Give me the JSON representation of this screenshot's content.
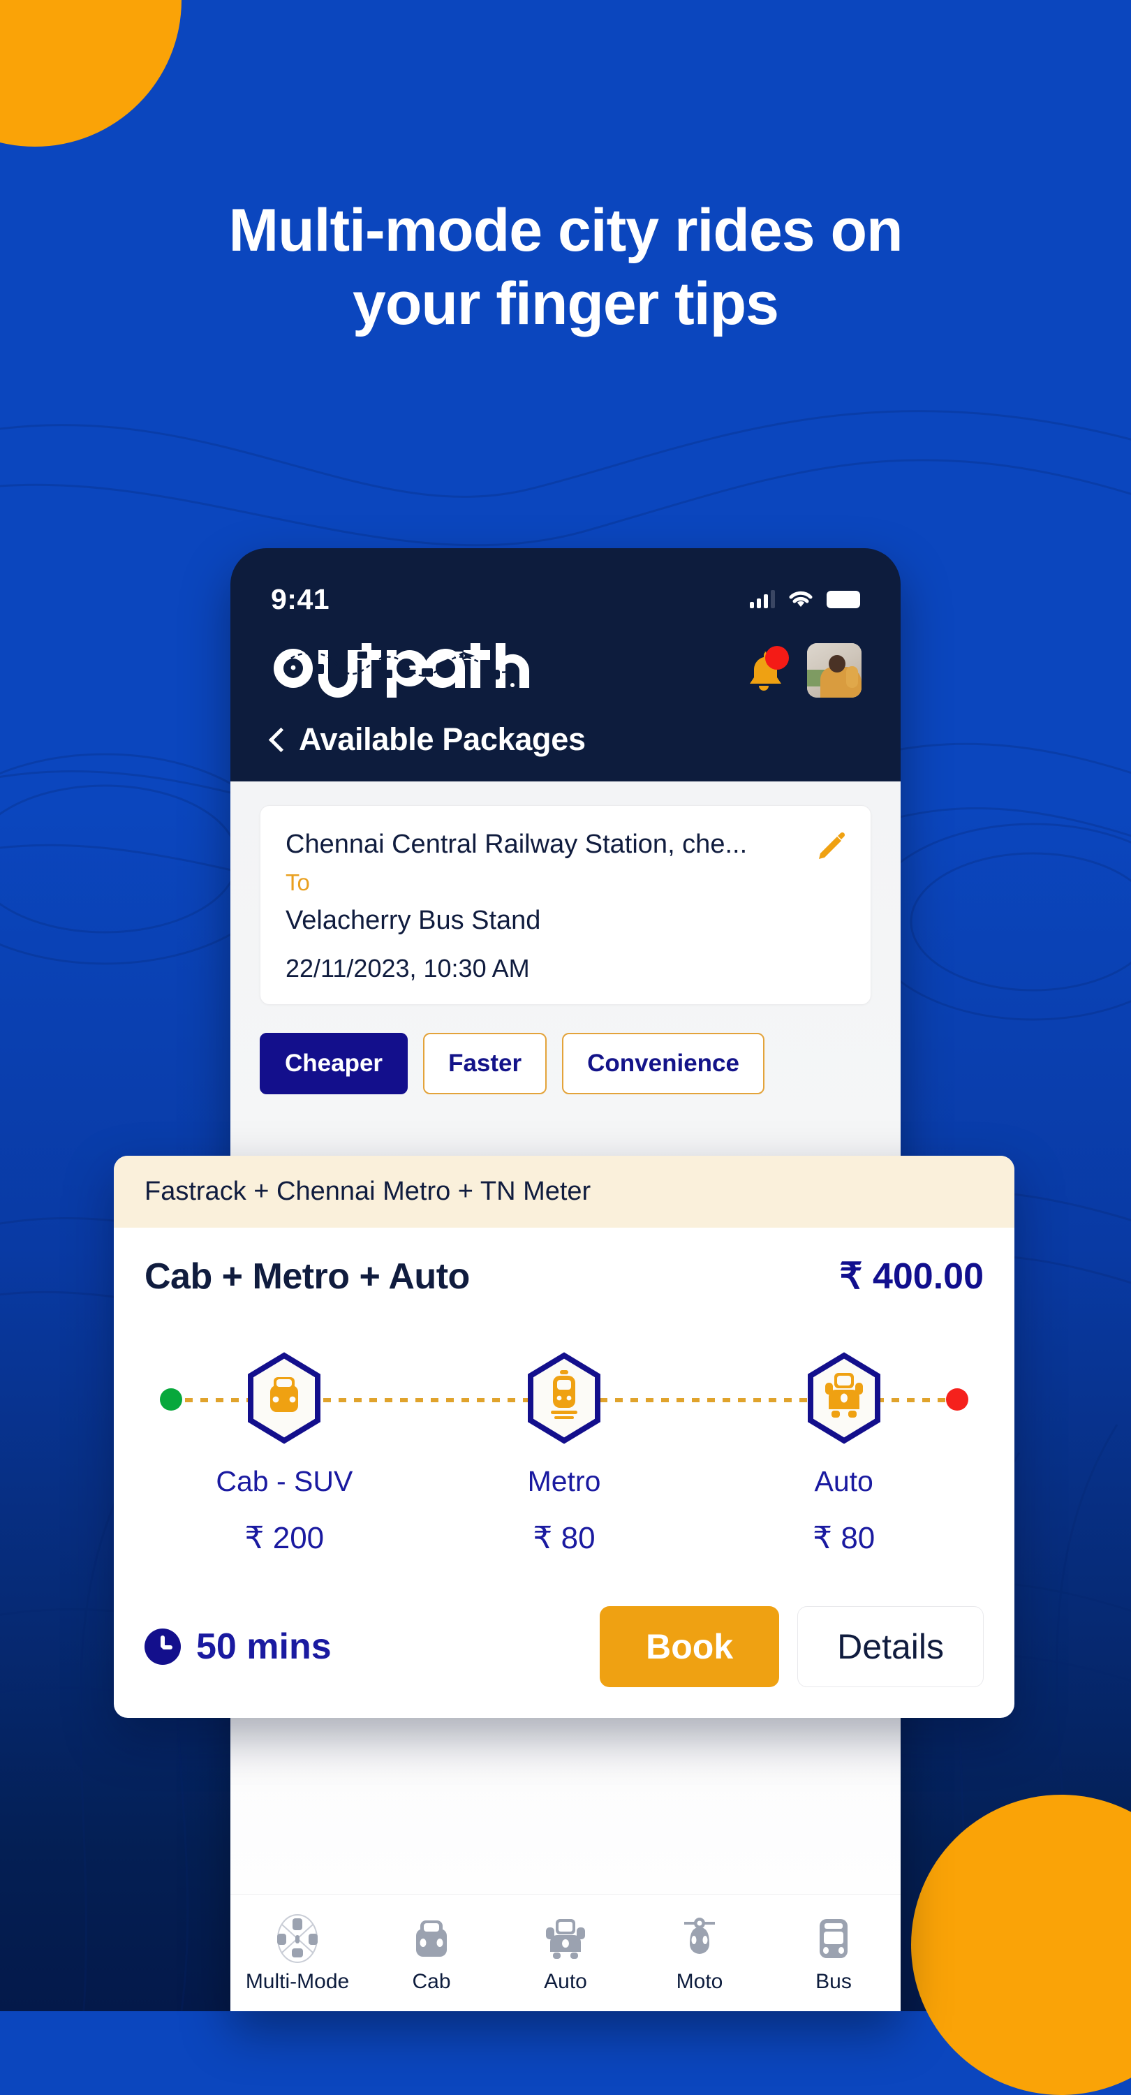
{
  "promo": {
    "headline_line1": "Multi-mode city rides on",
    "headline_line2": "your finger tips"
  },
  "colors": {
    "background_blue": "#0B46BE",
    "accent_orange": "#FAA307",
    "brand_navy": "#130F8C",
    "card_cream": "#FAF0DB",
    "start_dot_green": "#07A83C",
    "end_dot_red": "#F5211C"
  },
  "phone": {
    "status_bar": {
      "time": "9:41",
      "signal_icon": "cellular-signal-icon",
      "wifi_icon": "wifi-icon",
      "battery_icon": "battery-icon"
    },
    "app_header": {
      "logo_text": "outpath",
      "bell_icon": "notification-bell-icon",
      "has_notification_badge": true,
      "avatar_icon": "user-avatar"
    },
    "page": {
      "back_icon": "chevron-left-icon",
      "title": "Available Packages"
    },
    "route_card": {
      "from": "Chennai Central Railway Station, che...",
      "to_label": "To",
      "to": "Velacherry Bus Stand",
      "datetime": "22/11/2023,   10:30 AM",
      "edit_icon": "pencil-edit-icon"
    },
    "filters": [
      {
        "label": "Cheaper",
        "active": true
      },
      {
        "label": "Faster",
        "active": false
      },
      {
        "label": "Convenience",
        "active": false
      }
    ],
    "inline_package": {
      "nodes": [
        {
          "name": "Cab - SUV",
          "price": "₹ 200",
          "icon": "cab-icon"
        },
        {
          "name": "Metro",
          "price": "₹ 80",
          "icon": "metro-icon"
        },
        {
          "name": "Auto",
          "price": "₹ 80",
          "icon": "auto-rickshaw-icon"
        }
      ],
      "duration": "50 mins",
      "book_label": "Book",
      "details_label": "Details"
    },
    "bottom_nav": [
      {
        "label": "Multi-Mode",
        "icon": "multi-mode-icon",
        "active": true
      },
      {
        "label": "Cab",
        "icon": "cab-icon",
        "active": false
      },
      {
        "label": "Auto",
        "icon": "auto-rickshaw-icon",
        "active": false
      },
      {
        "label": "Moto",
        "icon": "moto-scooter-icon",
        "active": false
      },
      {
        "label": "Bus",
        "icon": "bus-icon",
        "active": false
      }
    ]
  },
  "feature_card": {
    "providers": "Fastrack  +  Chennai Metro  +  TN Meter",
    "title": "Cab + Metro + Auto",
    "price": "₹ 400.00",
    "nodes": [
      {
        "name": "Cab - SUV",
        "price": "₹ 200",
        "icon": "cab-icon"
      },
      {
        "name": "Metro",
        "price": "₹ 80",
        "icon": "metro-icon"
      },
      {
        "name": "Auto",
        "price": "₹ 80",
        "icon": "auto-rickshaw-icon"
      }
    ],
    "duration": "50 mins",
    "clock_icon": "clock-icon",
    "book_label": "Book",
    "details_label": "Details"
  }
}
